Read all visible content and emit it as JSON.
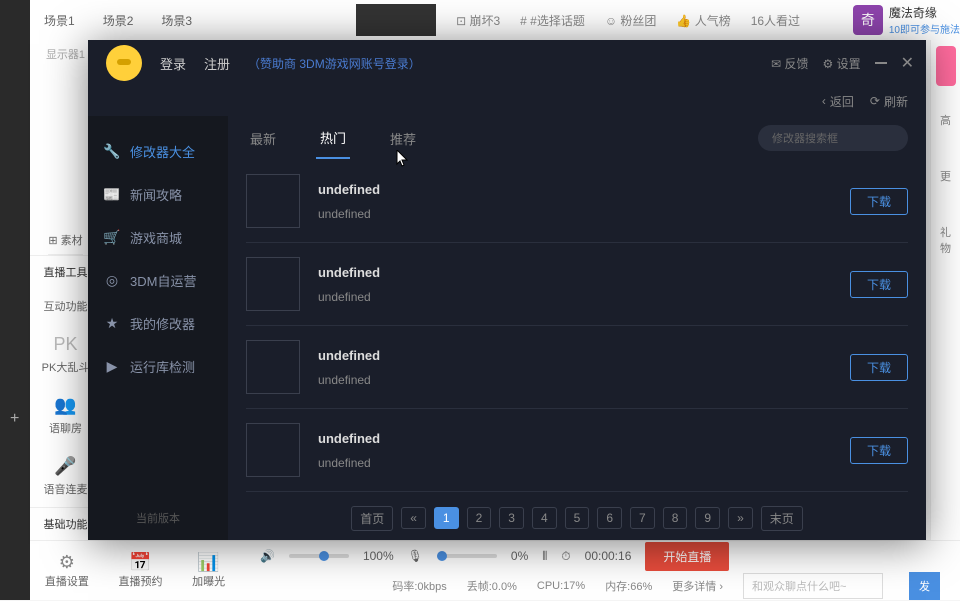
{
  "bg": {
    "scenes": [
      "场景1",
      "场景2",
      "场景3"
    ],
    "display": "显示器1",
    "sucai": "⊞ 素材",
    "tags": [
      "⊡ 崩坏3",
      "# #选择话题",
      "☺ 粉丝团",
      "👍 人气榜",
      "16人看过"
    ],
    "magic": {
      "icon": "奇",
      "title": "魔法奇缘",
      "sub": "10即可参与施法"
    },
    "live_tools": "直播工具",
    "sidebar_items": [
      {
        "icon": "⇄",
        "label": "互动功能"
      },
      {
        "icon": "PK",
        "label": "PK大乱斗"
      },
      {
        "icon": "👥",
        "label": "语聊房"
      },
      {
        "icon": "🎤",
        "label": "语音连麦"
      },
      {
        "icon": "≡",
        "label": "基础功能"
      }
    ],
    "bottom_tools": [
      {
        "icon": "⚙",
        "label": "直播设置"
      },
      {
        "icon": "📅",
        "label": "直播预约"
      },
      {
        "icon": "📊",
        "label": "加曝光"
      }
    ],
    "controls": {
      "vol_pct": "100%",
      "mic_pct": "0%",
      "timer": "00:00:16",
      "start": "开始直播",
      "stats": [
        "码率:0kbps",
        "丢帧:0.0%",
        "CPU:17%",
        "内存:66%",
        "更多详情 ›"
      ],
      "chat_placeholder": "和观众聊点什么吧~",
      "send": "发"
    },
    "right_items": [
      "高",
      "更",
      "礼物"
    ]
  },
  "modal": {
    "header": {
      "login": "登录",
      "register": "注册",
      "sponsor": "（赞助商 3DM游戏网账号登录）",
      "feedback": "反馈",
      "settings": "设置"
    },
    "subhead": {
      "back": "返回",
      "refresh": "刷新"
    },
    "nav": [
      {
        "icon": "🔧",
        "label": "修改器大全",
        "active": true
      },
      {
        "icon": "📰",
        "label": "新闻攻略"
      },
      {
        "icon": "🛒",
        "label": "游戏商城"
      },
      {
        "icon": "◎",
        "label": "3DM自运营"
      },
      {
        "icon": "★",
        "label": "我的修改器"
      },
      {
        "icon": "▶",
        "label": "运行库检测"
      }
    ],
    "version": "当前版本",
    "tabs": [
      "最新",
      "热门",
      "推荐"
    ],
    "active_tab": 1,
    "search_placeholder": "修改器搜索框",
    "items": [
      {
        "title": "undefined",
        "sub": "undefined"
      },
      {
        "title": "undefined",
        "sub": "undefined"
      },
      {
        "title": "undefined",
        "sub": "undefined"
      },
      {
        "title": "undefined",
        "sub": "undefined"
      }
    ],
    "download": "下载",
    "pager": {
      "first": "首页",
      "prev": "«",
      "pages": [
        "1",
        "2",
        "3",
        "4",
        "5",
        "6",
        "7",
        "8",
        "9"
      ],
      "next": "»",
      "last": "末页",
      "active": 0
    }
  }
}
